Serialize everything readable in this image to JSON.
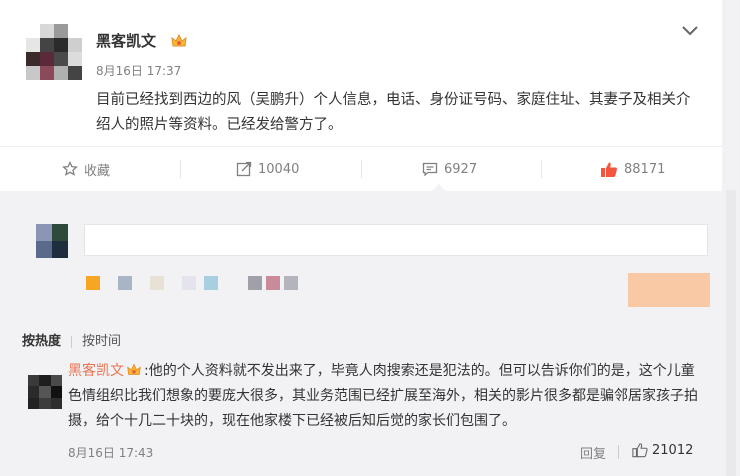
{
  "post": {
    "username": "黑客凯文",
    "time": "8月16日 17:37",
    "text": "目前已经找到西边的风（吴鹏升）个人信息，电话、身份证号码、家庭住址、其妻子及相关介绍人的照片等资料。已经发给警方了。",
    "badge_icon": "crown-badge-icon",
    "expand_icon": "chevron-down-icon"
  },
  "actions": {
    "favorite_label": "收藏",
    "repost_count": "10040",
    "comment_count": "6927",
    "like_count": "88171"
  },
  "sort": {
    "hot": "按热度",
    "time": "按时间"
  },
  "comment": {
    "username": "黑客凯文",
    "text": "他的个人资料就不发出来了，毕竟人肉搜索还是犯法的。但可以告诉你们的是，这个儿童色情组织比我们想象的要庞大很多，其业务范围已经扩展至海外，相关的影片很多都是骗邻居家孩子拍摄，给个十几二十块的，现在他家楼下已经被后知后觉的家长们包围了。",
    "time": "8月16日 17:43",
    "reply_label": "回复",
    "like_count": "21012"
  },
  "colors": {
    "accent": "#eb7350",
    "like_active": "#f5553f",
    "text_muted": "#808080"
  }
}
